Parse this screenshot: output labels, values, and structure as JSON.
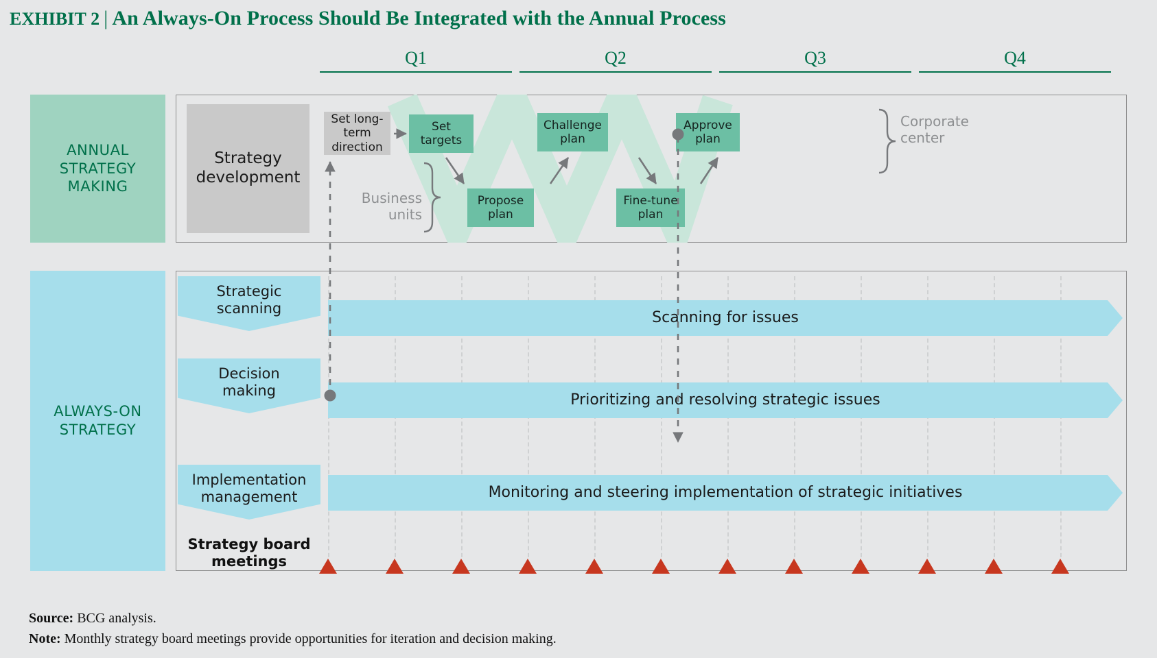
{
  "title": {
    "exhibit": "Exhibit 2",
    "separator": "|",
    "headline": "An Always-On Process Should Be Integrated with the Annual Process",
    "color": "#00704a"
  },
  "quarters": [
    {
      "label": "Q1"
    },
    {
      "label": "Q2"
    },
    {
      "label": "Q3"
    },
    {
      "label": "Q4"
    }
  ],
  "bands": {
    "annual": "ANNUAL\nSTRATEGY\nMAKING",
    "annual_l1": "ANNUAL",
    "annual_l2": "STRATEGY",
    "annual_l3": "MAKING",
    "always_l1": "ALWAYS-ON",
    "always_l2": "STRATEGY",
    "annual_color": "#9fd3c0",
    "always_color": "#a6deeb"
  },
  "annual": {
    "strategy_development": "Strategy\ndevelopment",
    "strategy_development_l1": "Strategy",
    "strategy_development_l2": "development",
    "set_long_term_direction_l1": "Set long-",
    "set_long_term_direction_l2": "term",
    "set_long_term_direction_l3": "direction",
    "set_targets_l1": "Set",
    "set_targets_l2": "targets",
    "propose_plan_l1": "Propose",
    "propose_plan_l2": "plan",
    "challenge_plan_l1": "Challenge",
    "challenge_plan_l2": "plan",
    "fine_tune_plan_l1": "Fine-tune",
    "fine_tune_plan_l2": "plan",
    "approve_plan_l1": "Approve",
    "approve_plan_l2": "plan",
    "corporate_center_l1": "Corporate",
    "corporate_center_l2": "center",
    "business_units_l1": "Business",
    "business_units_l2": "units",
    "box_color": "#6cbfa4",
    "gray_box_color": "#c9c9c9"
  },
  "always_on": {
    "rows": [
      {
        "label_l1": "Strategic",
        "label_l2": "scanning",
        "bar_text": "Scanning for issues"
      },
      {
        "label_l1": "Decision",
        "label_l2": "making",
        "bar_text": "Prioritizing and resolving strategic issues"
      },
      {
        "label_l1": "Implementation",
        "label_l2": "management",
        "bar_text": "Monitoring and steering implementation of strategic initiatives"
      }
    ],
    "strategy_board_meetings_l1": "Strategy board",
    "strategy_board_meetings_l2": "meetings",
    "meeting_marker_count": 12,
    "bar_color": "#a6deeb",
    "marker_color": "#c7371f"
  },
  "footer": {
    "source_label": "Source:",
    "source_text": "BCG analysis.",
    "note_label": "Note:",
    "note_text": "Monthly strategy board meetings provide opportunities for iteration and decision making."
  },
  "chart_data": {
    "type": "table",
    "title": "An Always-On Process Should Be Integrated with the Annual Process",
    "categories": [
      "Q1",
      "Q2",
      "Q3",
      "Q4"
    ],
    "annual_process_steps": [
      {
        "name": "Set long-term direction",
        "owner": "corporate center",
        "quarter": "pre-Q1",
        "style": "gray"
      },
      {
        "name": "Set targets",
        "owner": "corporate center",
        "quarter": "Q1",
        "style": "green"
      },
      {
        "name": "Propose plan",
        "owner": "business units",
        "quarter": "Q1",
        "style": "green"
      },
      {
        "name": "Challenge plan",
        "owner": "corporate center",
        "quarter": "Q2",
        "style": "green"
      },
      {
        "name": "Fine-tune plan",
        "owner": "business units",
        "quarter": "Q2",
        "style": "green"
      },
      {
        "name": "Approve plan",
        "owner": "corporate center",
        "quarter": "Q2/Q3",
        "style": "green"
      }
    ],
    "always_on_streams": [
      {
        "name": "Strategic scanning",
        "activity": "Scanning for issues",
        "span": "Q1-Q4"
      },
      {
        "name": "Decision making",
        "activity": "Prioritizing and resolving strategic issues",
        "span": "Q1-Q4"
      },
      {
        "name": "Implementation management",
        "activity": "Monitoring and steering implementation of strategic initiatives",
        "span": "Q1-Q4"
      }
    ],
    "strategy_board_meetings": 12,
    "xlabel": "",
    "ylabel": "",
    "grid": true,
    "legend": "none"
  }
}
